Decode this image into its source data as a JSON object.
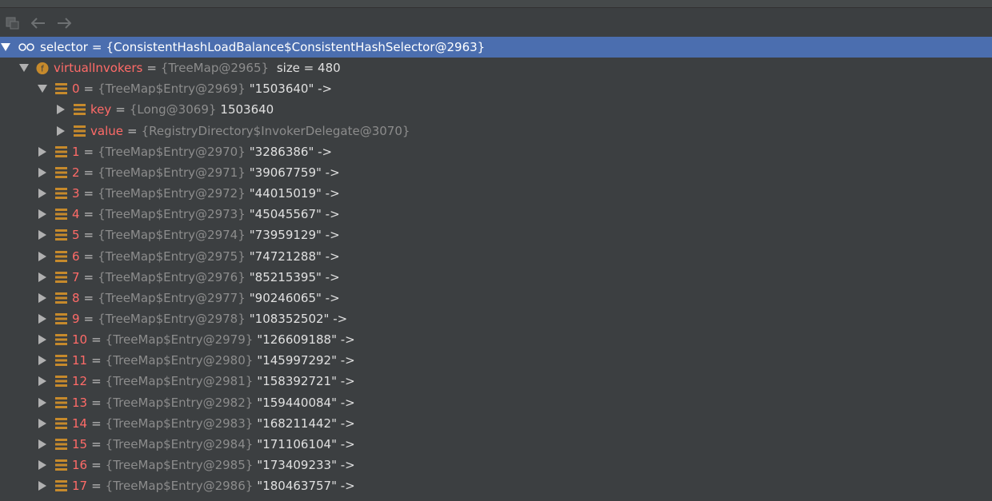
{
  "colors": {
    "background": "#3c3f41",
    "selection": "#4b6eaf",
    "field_name": "#ff6b68",
    "type_text": "#8c8c8c",
    "field_icon": "#c68a2c"
  },
  "toolbar": {
    "icons": [
      "restore-layout-icon",
      "back-arrow-icon",
      "forward-arrow-icon"
    ]
  },
  "root": {
    "name": "selector",
    "eq": "=",
    "type": "{ConsistentHashLoadBalance$ConsistentHashSelector@2963}",
    "value": ""
  },
  "virtual": {
    "name": "virtualInvokers",
    "eq": "=",
    "type": "{TreeMap@2965}",
    "value": " size = 480"
  },
  "entries": [
    {
      "name": "0",
      "eq": "=",
      "type": "{TreeMap$Entry@2969}",
      "value": "\"1503640\" ->"
    },
    {
      "name": "1",
      "eq": "=",
      "type": "{TreeMap$Entry@2970}",
      "value": "\"3286386\" ->"
    },
    {
      "name": "2",
      "eq": "=",
      "type": "{TreeMap$Entry@2971}",
      "value": "\"39067759\" ->"
    },
    {
      "name": "3",
      "eq": "=",
      "type": "{TreeMap$Entry@2972}",
      "value": "\"44015019\" ->"
    },
    {
      "name": "4",
      "eq": "=",
      "type": "{TreeMap$Entry@2973}",
      "value": "\"45045567\" ->"
    },
    {
      "name": "5",
      "eq": "=",
      "type": "{TreeMap$Entry@2974}",
      "value": "\"73959129\" ->"
    },
    {
      "name": "6",
      "eq": "=",
      "type": "{TreeMap$Entry@2975}",
      "value": "\"74721288\" ->"
    },
    {
      "name": "7",
      "eq": "=",
      "type": "{TreeMap$Entry@2976}",
      "value": "\"85215395\" ->"
    },
    {
      "name": "8",
      "eq": "=",
      "type": "{TreeMap$Entry@2977}",
      "value": "\"90246065\" ->"
    },
    {
      "name": "9",
      "eq": "=",
      "type": "{TreeMap$Entry@2978}",
      "value": "\"108352502\" ->"
    },
    {
      "name": "10",
      "eq": "=",
      "type": "{TreeMap$Entry@2979}",
      "value": "\"126609188\" ->"
    },
    {
      "name": "11",
      "eq": "=",
      "type": "{TreeMap$Entry@2980}",
      "value": "\"145997292\" ->"
    },
    {
      "name": "12",
      "eq": "=",
      "type": "{TreeMap$Entry@2981}",
      "value": "\"158392721\" ->"
    },
    {
      "name": "13",
      "eq": "=",
      "type": "{TreeMap$Entry@2982}",
      "value": "\"159440084\" ->"
    },
    {
      "name": "14",
      "eq": "=",
      "type": "{TreeMap$Entry@2983}",
      "value": "\"168211442\" ->"
    },
    {
      "name": "15",
      "eq": "=",
      "type": "{TreeMap$Entry@2984}",
      "value": "\"171106104\" ->"
    },
    {
      "name": "16",
      "eq": "=",
      "type": "{TreeMap$Entry@2985}",
      "value": "\"173409233\" ->"
    },
    {
      "name": "17",
      "eq": "=",
      "type": "{TreeMap$Entry@2986}",
      "value": "\"180463757\" ->"
    }
  ],
  "entry0_children": [
    {
      "name": "key",
      "eq": "=",
      "type": "{Long@3069}",
      "value": "1503640"
    },
    {
      "name": "value",
      "eq": "=",
      "type": "{RegistryDirectory$InvokerDelegate@3070}",
      "value": ""
    }
  ]
}
